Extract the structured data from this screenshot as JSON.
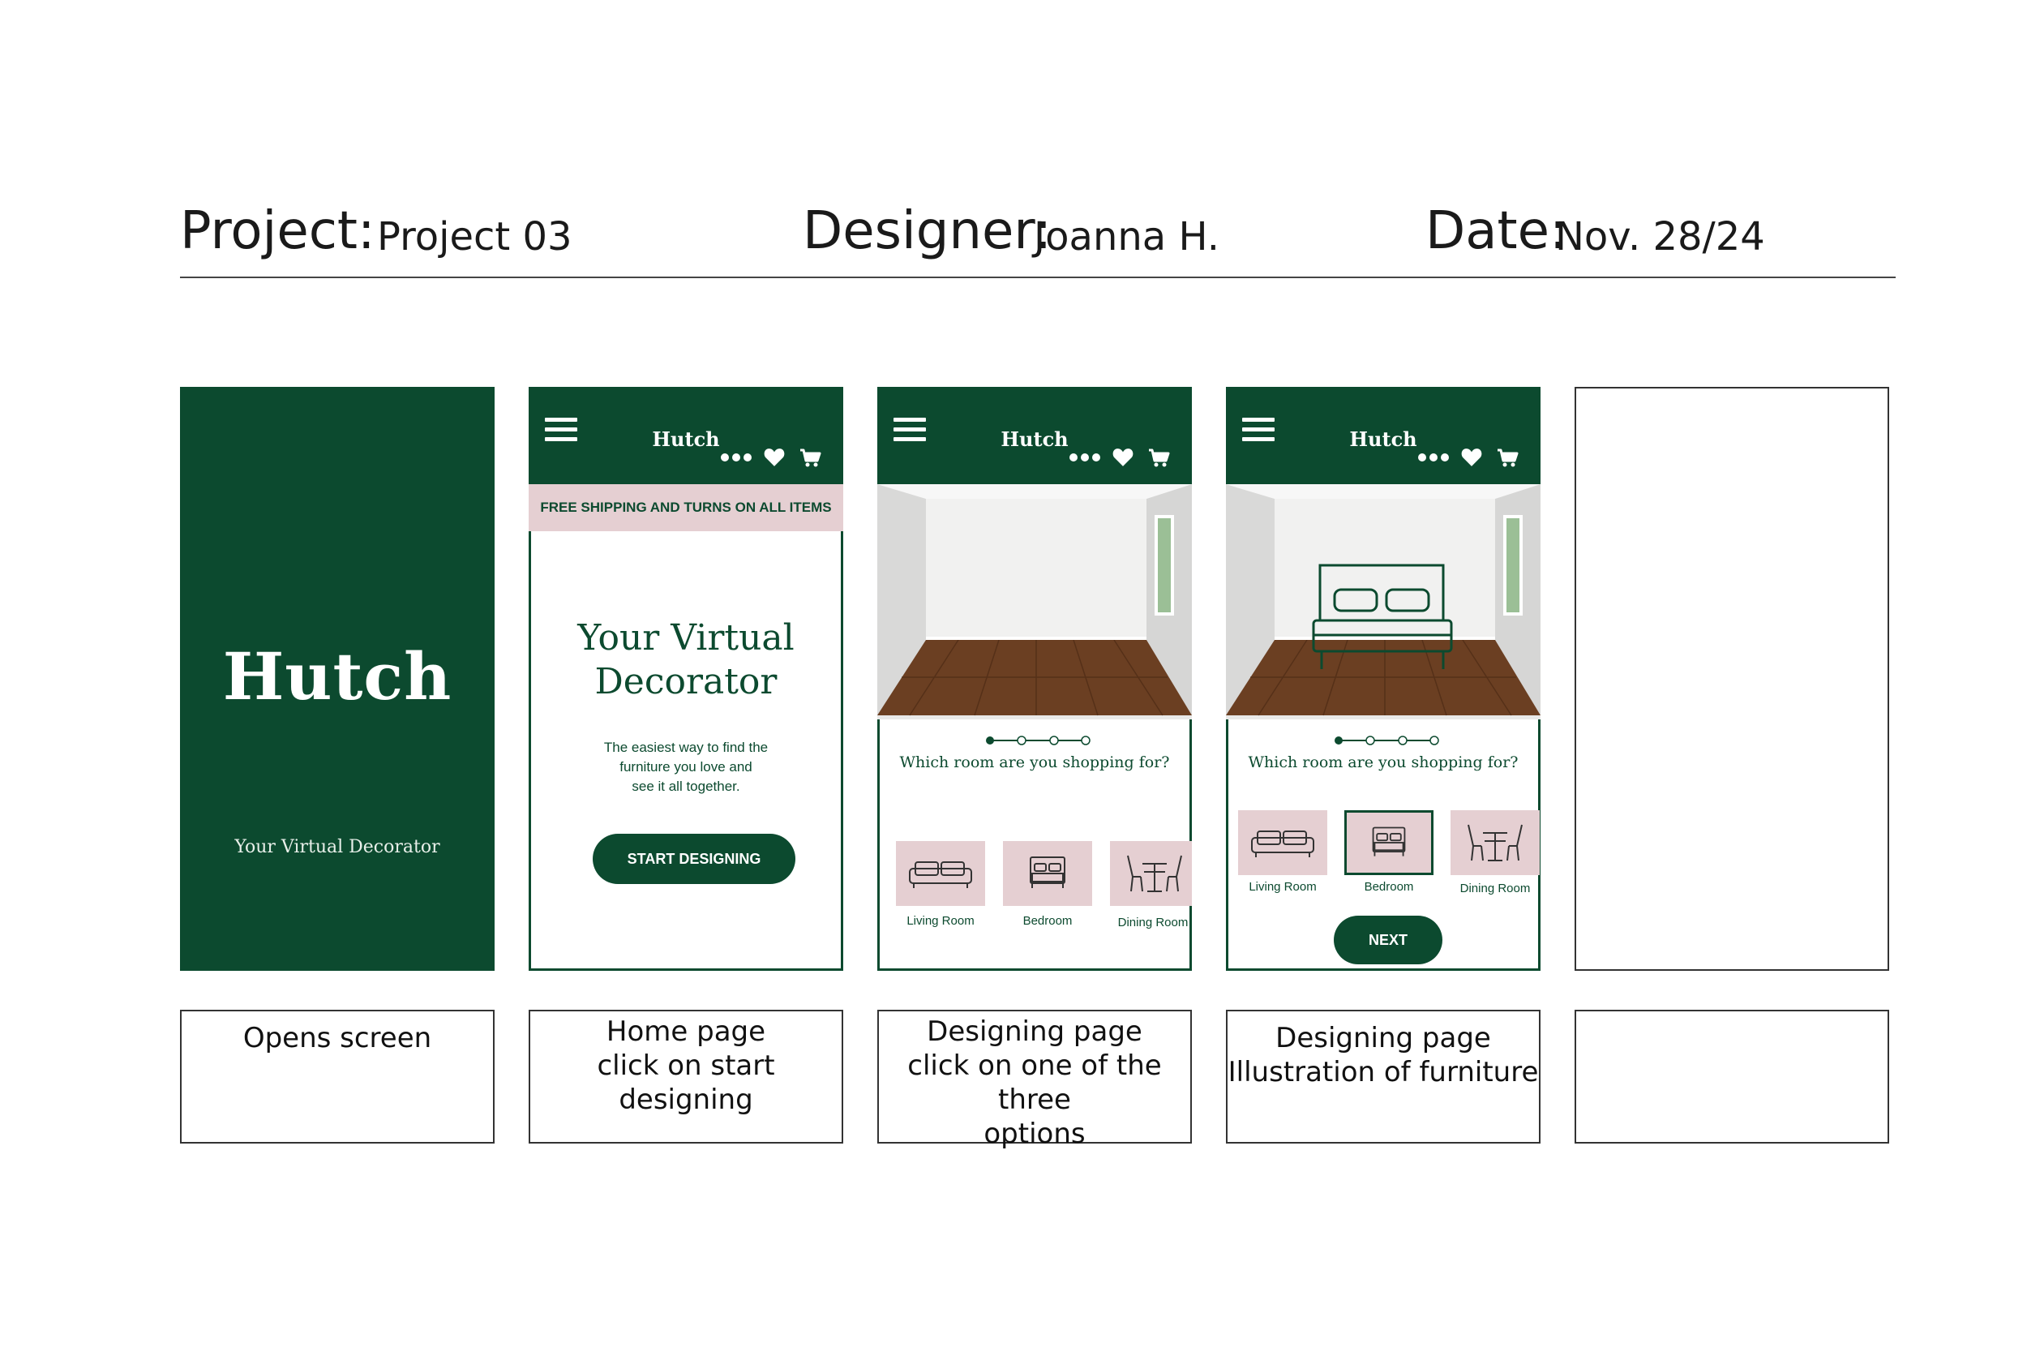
{
  "header": {
    "project_label": "Project:",
    "project_value": "Project 03",
    "designer_label": "Designer:",
    "designer_value": "Joanna H.",
    "date_label": "Date:",
    "date_value": "Nov. 28/24"
  },
  "brand": {
    "name": "Hutch",
    "tagline": "Your Virtual Decorator",
    "color_primary": "#0c4a2f",
    "color_accent": "#e5cfd2"
  },
  "home": {
    "promo": "FREE SHIPPING AND TURNS ON ALL ITEMS",
    "title_line1": "Your Virtual",
    "title_line2": "Decorator",
    "sub_line1": "The easiest way to find the",
    "sub_line2": "furniture you love and",
    "sub_line3": "see it all together.",
    "cta": "START DESIGNING"
  },
  "designing": {
    "question": "Which room are you shopping for?",
    "options": [
      "Living Room",
      "Bedroom",
      "Dining Room"
    ],
    "next": "NEXT",
    "step_current": 1,
    "step_total": 4
  },
  "header_icons": [
    "menu-icon",
    "more-icon",
    "heart-icon",
    "cart-icon"
  ],
  "captions": [
    {
      "line1": "Opens screen",
      "line2": "",
      "line3": ""
    },
    {
      "line1": "Home page",
      "line2": "click on start designing",
      "line3": ""
    },
    {
      "line1": "Designing page",
      "line2": "click on one of the three",
      "line3": "options"
    },
    {
      "line1": "Designing page",
      "line2": "Illustration of furniture",
      "line3": ""
    },
    {
      "line1": "",
      "line2": "",
      "line3": ""
    }
  ]
}
